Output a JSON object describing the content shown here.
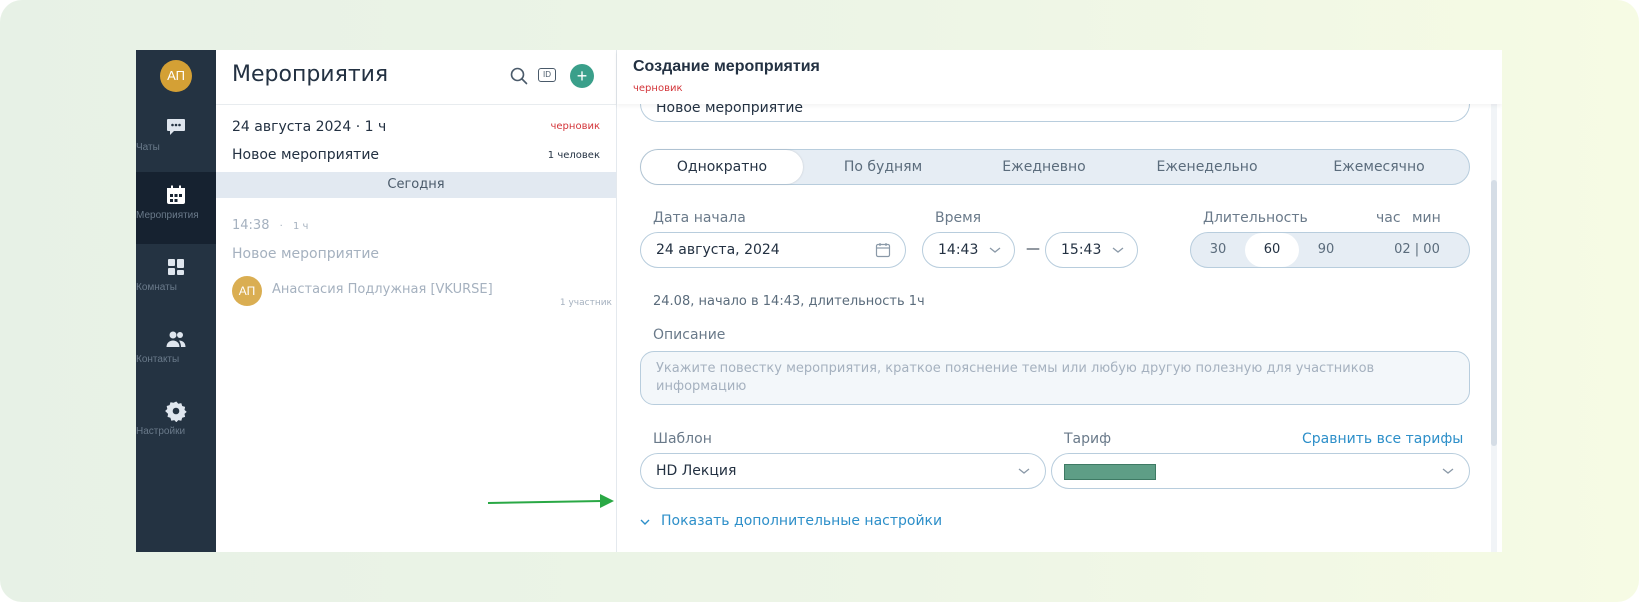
{
  "nav": {
    "avatar_initials": "АП",
    "items": [
      {
        "label": "Чаты",
        "icon": "chat-icon"
      },
      {
        "label": "Мероприятия",
        "icon": "calendar-icon"
      },
      {
        "label": "Комнаты",
        "icon": "rooms-icon"
      },
      {
        "label": "Контакты",
        "icon": "contacts-icon"
      },
      {
        "label": "Настройки",
        "icon": "gear-icon"
      }
    ]
  },
  "list": {
    "title": "Мероприятия",
    "id_label": "ID",
    "add_label": "+",
    "events": [
      {
        "date": "24 августа 2024 · 1 ч",
        "status": "черновик",
        "name": "Новое мероприятие",
        "count": "1 человек"
      }
    ],
    "section_today": "Сегодня",
    "today_event": {
      "time": "14:38",
      "dot": "·",
      "duration": "1 ч",
      "name": "Новое мероприятие",
      "avatar_initials": "АП",
      "user": "Анастасия Подлужная [VKURSE]",
      "participants": "1 участник"
    }
  },
  "form": {
    "title": "Создание мероприятия",
    "status": "черновик",
    "name_value": "Новое мероприятие",
    "repeat_options": [
      "Однократно",
      "По будням",
      "Ежедневно",
      "Еженедельно",
      "Ежемесячно"
    ],
    "repeat_selected": "Однократно",
    "start_date_label": "Дата начала",
    "start_date_value": "24 августа, 2024",
    "time_label": "Время",
    "time_from": "14:43",
    "time_dash": "—",
    "time_to": "15:43",
    "duration_label": "Длительность",
    "duration_hour_label": "час",
    "duration_min_label": "мин",
    "duration_options": [
      "30",
      "60",
      "90",
      "02 | 00"
    ],
    "duration_selected": "60",
    "summary": "24.08, начало в 14:43, длительность 1ч",
    "description_label": "Описание",
    "description_placeholder": "Укажите повестку мероприятия, краткое пояснение темы или любую другую полезную для участников информацию",
    "template_label": "Шаблон",
    "template_value": "HD Лекция",
    "tariff_label": "Тариф",
    "compare_link": "Сравнить все тарифы",
    "more_settings": "Показать дополнительные настройки"
  },
  "colors": {
    "accent": "#2d8fc9",
    "nav_bg": "#243342",
    "draft": "#d3353a",
    "add_button": "#3a9f8a",
    "arrow": "#2aa845"
  }
}
